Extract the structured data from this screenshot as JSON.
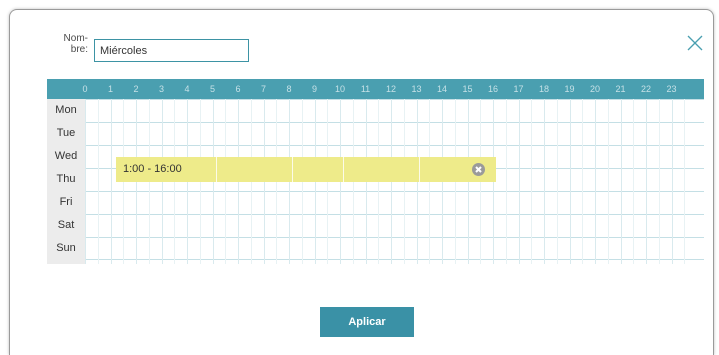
{
  "name_field": {
    "label": "Nom-\nbre:",
    "value": "Miércoles"
  },
  "schedule": {
    "hours": [
      "0",
      "1",
      "2",
      "3",
      "4",
      "5",
      "6",
      "7",
      "8",
      "9",
      "10",
      "11",
      "12",
      "13",
      "14",
      "15",
      "16",
      "17",
      "18",
      "19",
      "20",
      "21",
      "22",
      "23"
    ],
    "days": [
      "Mon",
      "Tue",
      "Wed",
      "Thu",
      "Fri",
      "Sat",
      "Sun"
    ],
    "block": {
      "label": "1:00 - 16:00",
      "color": "#eeeb8a"
    }
  },
  "actions": {
    "apply_label": "Aplicar"
  },
  "colors": {
    "header": "#4a9fb0",
    "accent": "#3a91a6",
    "grid_line": "#c4dfe5"
  },
  "icons": {
    "close": "close-x-icon",
    "remove": "remove-circle-icon"
  }
}
